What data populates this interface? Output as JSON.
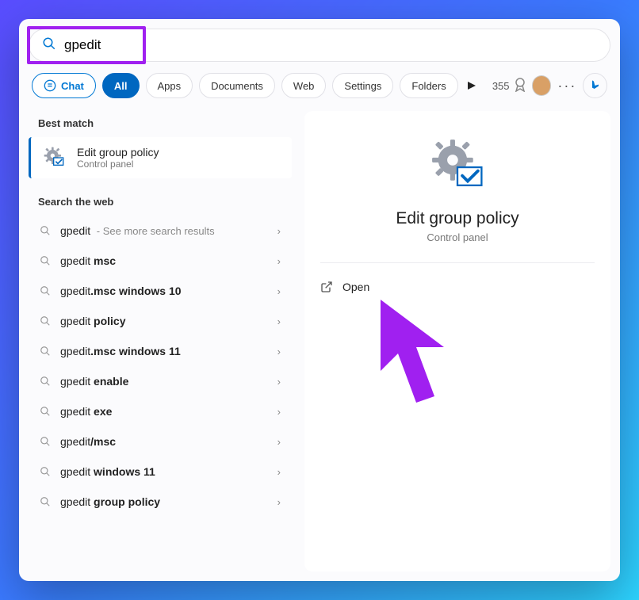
{
  "search": {
    "query": "gpedit"
  },
  "filters": {
    "chat": "Chat",
    "all": "All",
    "apps": "Apps",
    "documents": "Documents",
    "web": "Web",
    "settings": "Settings",
    "folders": "Folders"
  },
  "header": {
    "points": "355"
  },
  "sections": {
    "best_match": "Best match",
    "search_web": "Search the web"
  },
  "best_match": {
    "title": "Edit group policy",
    "subtitle": "Control panel"
  },
  "web_results": [
    {
      "prefix": "gpedit",
      "bold": "",
      "suffix": " - See more search results"
    },
    {
      "prefix": "gpedit ",
      "bold": "msc",
      "suffix": ""
    },
    {
      "prefix": "gpedit",
      "bold": ".msc windows 10",
      "suffix": ""
    },
    {
      "prefix": "gpedit ",
      "bold": "policy",
      "suffix": ""
    },
    {
      "prefix": "gpedit",
      "bold": ".msc windows 11",
      "suffix": ""
    },
    {
      "prefix": "gpedit ",
      "bold": "enable",
      "suffix": ""
    },
    {
      "prefix": "gpedit ",
      "bold": "exe",
      "suffix": ""
    },
    {
      "prefix": "gpedit",
      "bold": "/msc",
      "suffix": ""
    },
    {
      "prefix": "gpedit ",
      "bold": "windows 11",
      "suffix": ""
    },
    {
      "prefix": "gpedit ",
      "bold": "group policy",
      "suffix": ""
    }
  ],
  "detail": {
    "title": "Edit group policy",
    "subtitle": "Control panel",
    "open": "Open"
  }
}
